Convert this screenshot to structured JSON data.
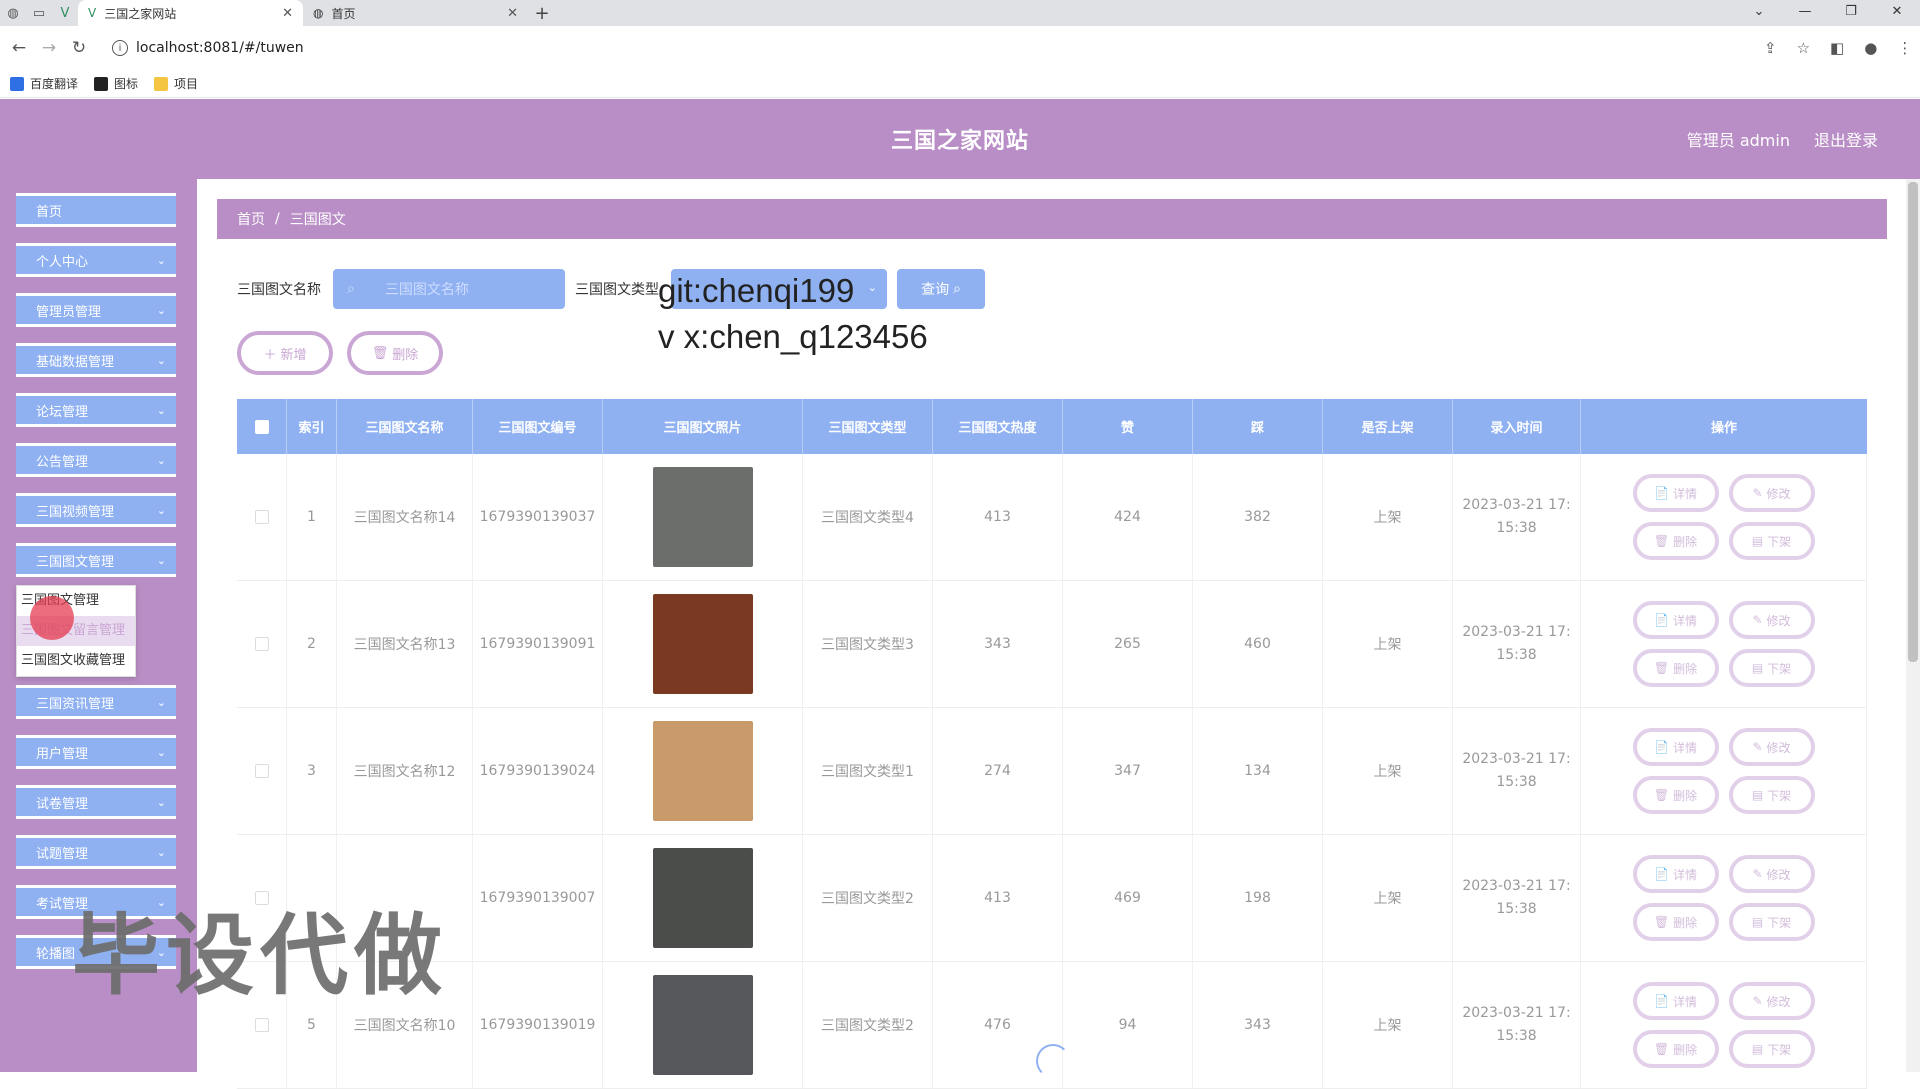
{
  "browser": {
    "tabs": [
      {
        "label": "三国之家网站",
        "active": true
      },
      {
        "label": "首页",
        "active": false
      }
    ],
    "url": "localhost:8081/#/tuwen",
    "bookmarks": [
      "百度翻译",
      "图标",
      "项目"
    ]
  },
  "header": {
    "title": "三国之家网站",
    "user": "管理员 admin",
    "logout": "退出登录"
  },
  "sidebar": {
    "items": [
      "首页",
      "个人中心",
      "管理员管理",
      "基础数据管理",
      "论坛管理",
      "公告管理",
      "三国视频管理",
      "三国图文管理",
      "三国资讯管理",
      "用户管理",
      "试卷管理",
      "试题管理",
      "考试管理",
      "轮播图"
    ],
    "submenu": [
      "三国图文管理",
      "三国图文留言管理",
      "三国图文收藏管理"
    ]
  },
  "breadcrumb": {
    "home": "首页",
    "sep": "/",
    "current": "三国图文"
  },
  "search": {
    "name_label": "三国图文名称",
    "name_placeholder": "三国图文名称",
    "type_label": "三国图文类型",
    "query_button": "查询"
  },
  "actions": {
    "add": "新增",
    "delete": "删除"
  },
  "table": {
    "headers": [
      "索引",
      "三国图文名称",
      "三国图文编号",
      "三国图文照片",
      "三国图文类型",
      "三国图文热度",
      "赞",
      "踩",
      "是否上架",
      "录入时间",
      "操作"
    ],
    "rows": [
      {
        "index": "1",
        "name": "三国图文名称14",
        "code": "1679390139037",
        "type": "三国图文类型4",
        "heat": "413",
        "like": "424",
        "dislike": "382",
        "shelf": "上架",
        "date": "2023-03-21 17:",
        "time": "15:38",
        "pic_color": "#6b6e6a"
      },
      {
        "index": "2",
        "name": "三国图文名称13",
        "code": "1679390139091",
        "type": "三国图文类型3",
        "heat": "343",
        "like": "265",
        "dislike": "460",
        "shelf": "上架",
        "date": "2023-03-21 17:",
        "time": "15:38",
        "pic_color": "#7a3a22"
      },
      {
        "index": "3",
        "name": "三国图文名称12",
        "code": "1679390139024",
        "type": "三国图文类型1",
        "heat": "274",
        "like": "347",
        "dislike": "134",
        "shelf": "上架",
        "date": "2023-03-21 17:",
        "time": "15:38",
        "pic_color": "#c99a6a"
      },
      {
        "index": "",
        "name": "",
        "code": "1679390139007",
        "type": "三国图文类型2",
        "heat": "413",
        "like": "469",
        "dislike": "198",
        "shelf": "上架",
        "date": "2023-03-21 17:",
        "time": "15:38",
        "pic_color": "#4a4d4a"
      },
      {
        "index": "5",
        "name": "三国图文名称10",
        "code": "1679390139019",
        "type": "三国图文类型2",
        "heat": "476",
        "like": "94",
        "dislike": "343",
        "shelf": "上架",
        "date": "2023-03-21 17:",
        "time": "15:38",
        "pic_color": "#55575a"
      }
    ],
    "op_labels": {
      "detail": "详情",
      "edit": "修改",
      "delete": "删除",
      "unshelf": "下架"
    }
  },
  "overlays": {
    "git": "git:chenqi199",
    "wx": "v x:chen_q123456",
    "banner": "毕设代做"
  }
}
